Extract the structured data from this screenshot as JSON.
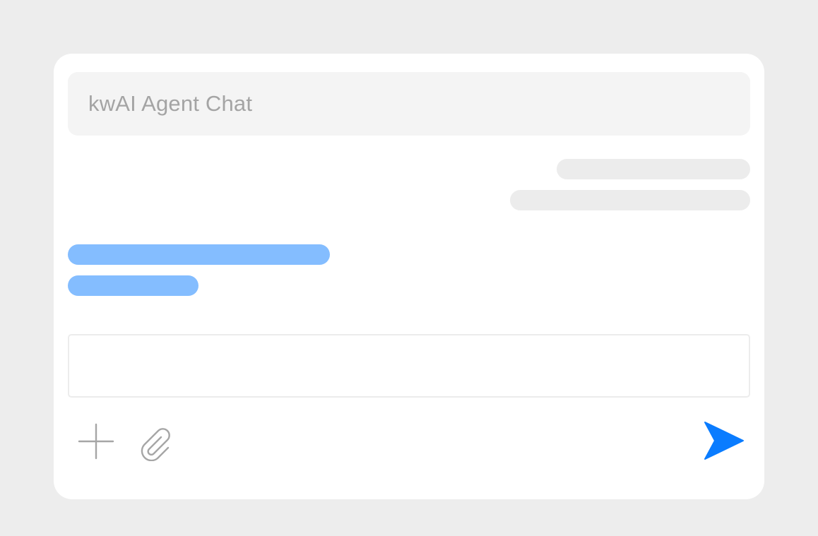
{
  "chat": {
    "title": "kwAI Agent Chat"
  },
  "messages": [
    {
      "sender": "agent",
      "align": "right"
    },
    {
      "sender": "agent",
      "align": "right"
    },
    {
      "sender": "user",
      "align": "left"
    },
    {
      "sender": "user",
      "align": "left"
    }
  ],
  "input": {
    "value": "",
    "placeholder": ""
  },
  "toolbar": {
    "icons": [
      "plus-icon",
      "paperclip-icon",
      "send-icon"
    ]
  },
  "colors": {
    "page_background": "#ededed",
    "card_background": "#ffffff",
    "header_background": "#f4f4f4",
    "title_text": "#a4a4a4",
    "agent_bubble": "#ececec",
    "user_bubble": "#84bdff",
    "send_accent": "#0a7cff",
    "icon_gray": "#a6a6a6"
  }
}
